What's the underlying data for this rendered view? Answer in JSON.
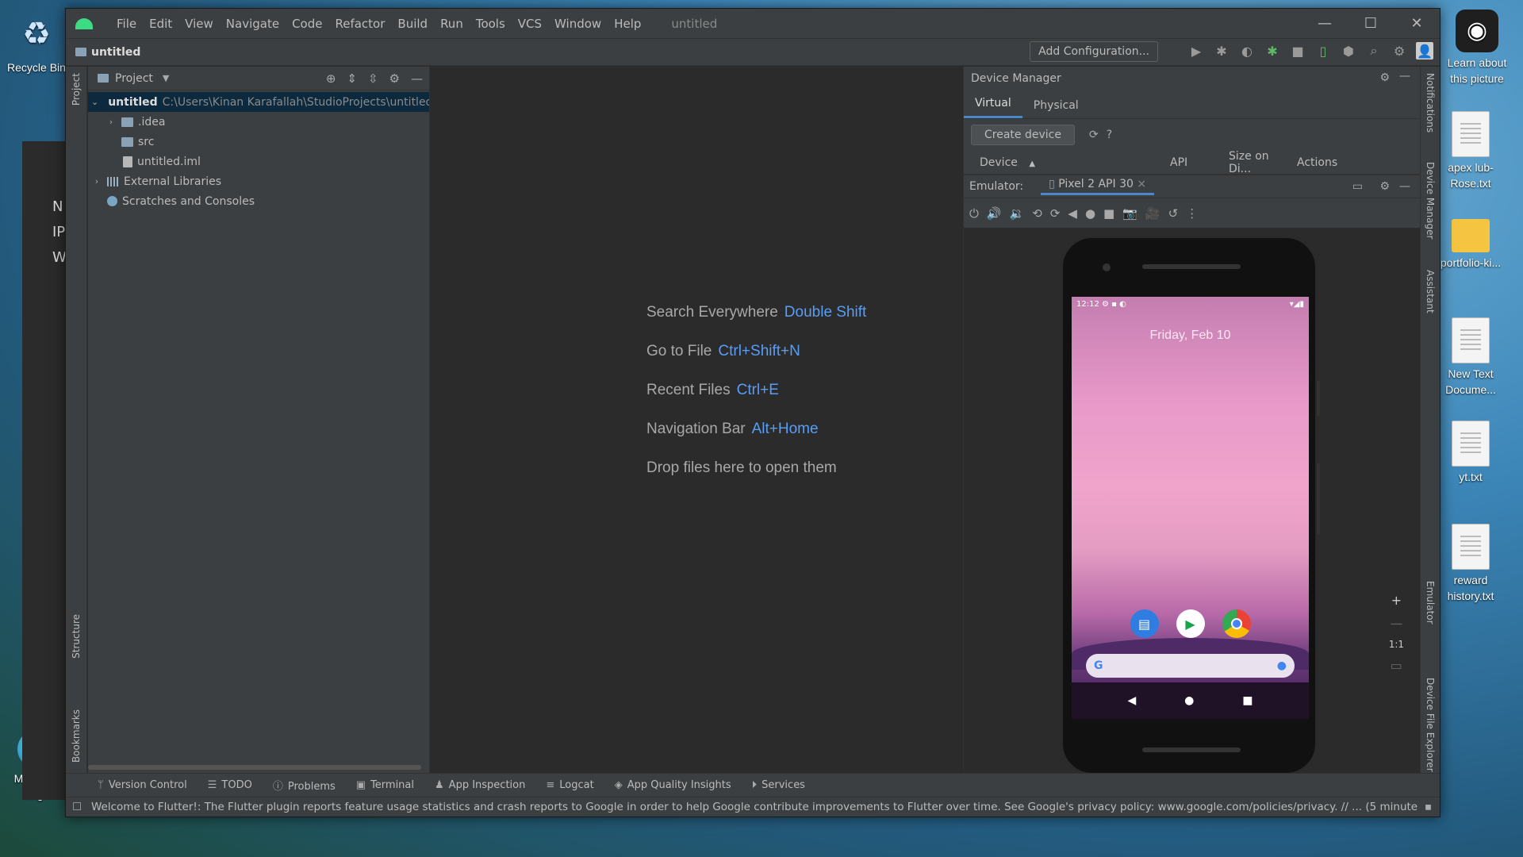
{
  "desktop": {
    "icons": [
      {
        "label": "Recycle Bin"
      },
      {
        "label": "Learn about this picture"
      },
      {
        "label": "apex lub-Rose.txt"
      },
      {
        "label": "portfolio-ki..."
      },
      {
        "label": "New Text Docume..."
      },
      {
        "label": "yt.txt"
      },
      {
        "label": "reward history.txt"
      },
      {
        "label": "Microsoft Edge"
      }
    ],
    "ghost_texts": [
      "N",
      "IP",
      "W"
    ]
  },
  "ide": {
    "menu": [
      "File",
      "Edit",
      "View",
      "Navigate",
      "Code",
      "Refactor",
      "Build",
      "Run",
      "Tools",
      "VCS",
      "Window",
      "Help"
    ],
    "window_title": "untitled",
    "project_name": "untitled",
    "add_configuration": "Add Configuration...",
    "left_strip": {
      "project": "Project",
      "structure": "Structure",
      "bookmarks": "Bookmarks"
    },
    "right_strip": {
      "notifications": "Notifications",
      "device_manager": "Device Manager",
      "assistant": "Assistant",
      "emulator": "Emulator",
      "device_file_explorer": "Device File Explorer"
    },
    "project_panel": {
      "title": "Project",
      "tree": [
        {
          "name": "untitled",
          "path": "C:\\Users\\Kinan Karafallah\\StudioProjects\\untitled"
        },
        {
          "name": ".idea"
        },
        {
          "name": "src"
        },
        {
          "name": "untitled.iml"
        },
        {
          "name": "External Libraries"
        },
        {
          "name": "Scratches and Consoles"
        }
      ]
    },
    "editor_hints": [
      {
        "label": "Search Everywhere",
        "key": "Double Shift"
      },
      {
        "label": "Go to File",
        "key": "Ctrl+Shift+N"
      },
      {
        "label": "Recent Files",
        "key": "Ctrl+E"
      },
      {
        "label": "Navigation Bar",
        "key": "Alt+Home"
      },
      {
        "label": "Drop files here to open them",
        "key": ""
      }
    ],
    "device_manager": {
      "title": "Device Manager",
      "tabs": [
        "Virtual",
        "Physical"
      ],
      "create_device": "Create device",
      "columns": [
        "Device",
        "API",
        "Size on Di...",
        "Actions"
      ]
    },
    "emulator": {
      "label": "Emulator:",
      "tab": "Pixel 2 API 30",
      "phone": {
        "time": "12:12",
        "date": "Friday, Feb 10"
      },
      "zoom_reset": "1:1"
    },
    "bottom_tools": [
      "Version Control",
      "TODO",
      "Problems",
      "Terminal",
      "App Inspection",
      "Logcat",
      "App Quality Insights",
      "Services"
    ],
    "status_message": "Welcome to Flutter!: The Flutter plugin reports feature usage statistics and crash reports to Google in order to help Google contribute improvements to Flutter over time. See Google's privacy policy: www.google.com/policies/privacy. // ... (5 minute"
  }
}
